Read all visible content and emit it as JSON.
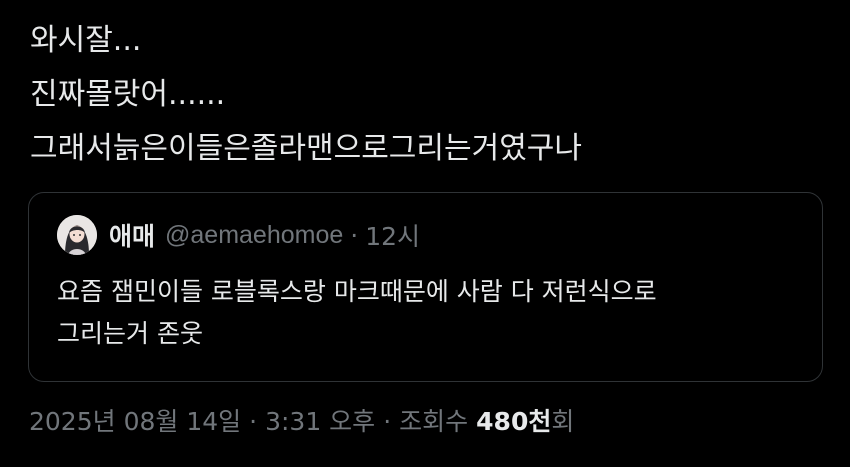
{
  "tweet": {
    "lines": [
      "와시잘...",
      "진짜몰랏어......",
      "그래서늙은이들은졸라맨으로그리는거였구나"
    ]
  },
  "quote": {
    "author_name": "애매",
    "author_handle": "@aemaehomoe",
    "separator": "·",
    "time": "12시",
    "avatar_icon": "profile-avatar",
    "body_lines": [
      "요즘 잼민이들 로블록스랑 마크때문에 사람 다 저런식으로",
      "그리는거 존웃"
    ]
  },
  "meta": {
    "date": "2025년 08월 14일",
    "time": "3:31 오후",
    "views_label": "조회수",
    "views_count": "480천",
    "views_suffix": "회",
    "separator": "·"
  },
  "colors": {
    "background": "#000000",
    "text_primary": "#e7e9ea",
    "text_secondary": "#71767b",
    "border": "#2f3336"
  }
}
